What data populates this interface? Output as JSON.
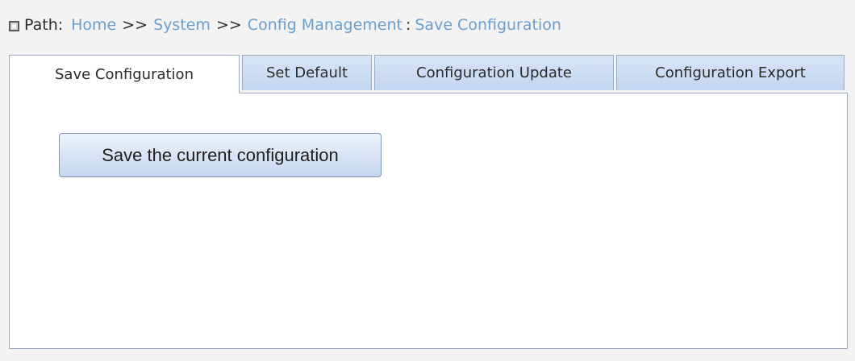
{
  "breadcrumb": {
    "icon": "square-icon",
    "label": "Path:",
    "home": "Home",
    "sep1": ">>",
    "system": "System",
    "sep2": ">>",
    "config_management": "Config Management",
    "colon": ":",
    "current": "Save Configuration"
  },
  "tabs": [
    {
      "label": "Save Configuration",
      "active": true
    },
    {
      "label": "Set Default",
      "active": false
    },
    {
      "label": "Configuration Update",
      "active": false
    },
    {
      "label": "Configuration Export",
      "active": false
    }
  ],
  "panel": {
    "save_button_label": "Save the current configuration"
  },
  "colors": {
    "link": "#6a9ecf",
    "tab_inactive": "#c9daf2",
    "border": "#9cabbd"
  }
}
